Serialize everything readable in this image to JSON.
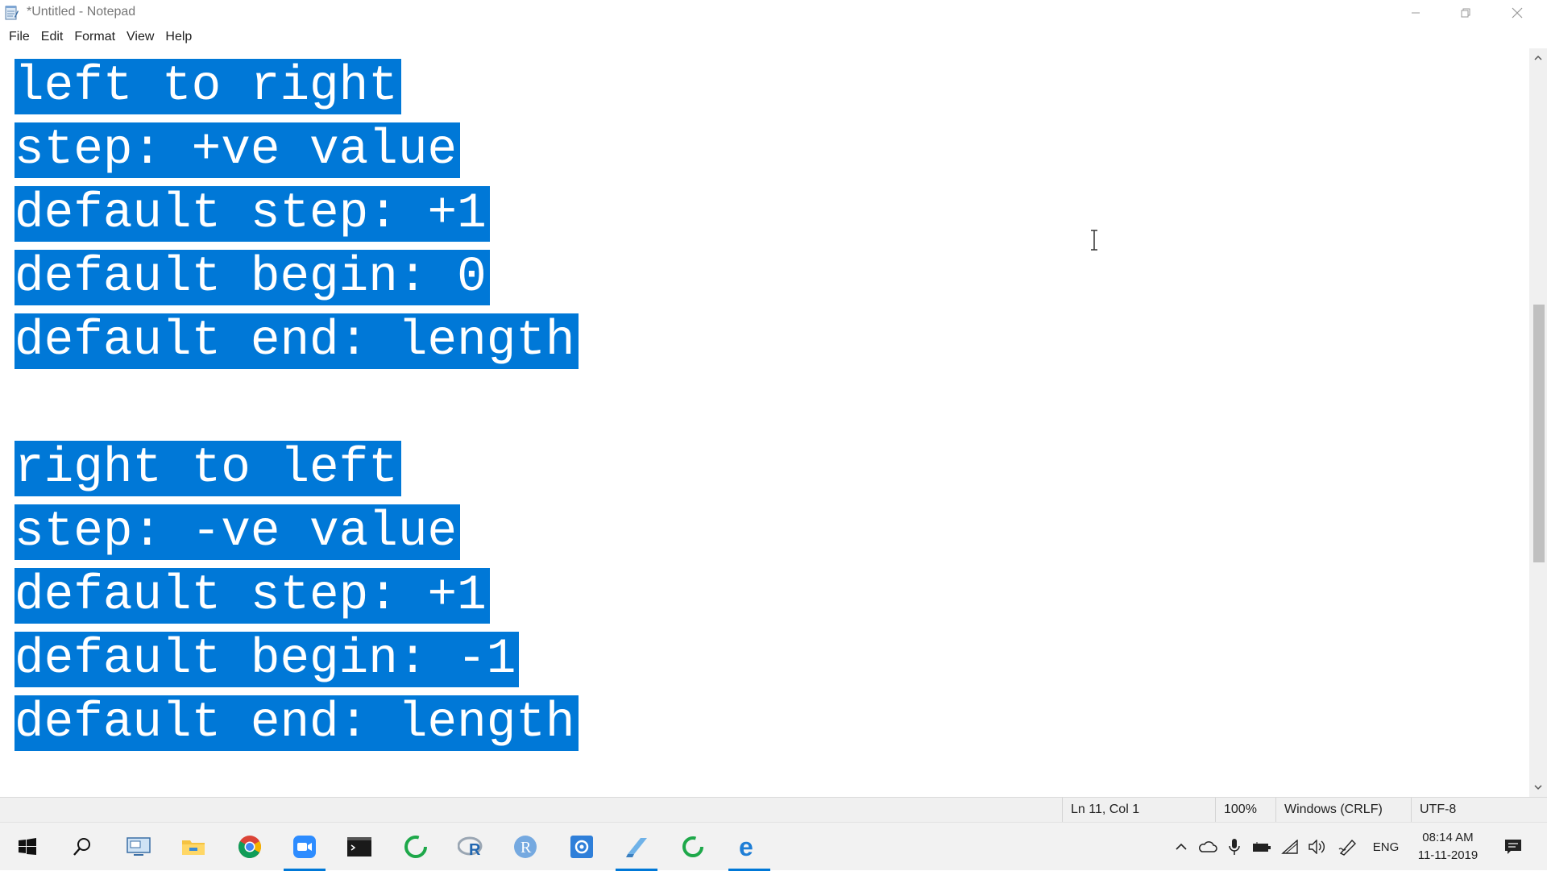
{
  "window": {
    "title": "*Untitled - Notepad"
  },
  "menu": {
    "items": [
      "File",
      "Edit",
      "Format",
      "View",
      "Help"
    ]
  },
  "editor": {
    "lines": [
      "left to right",
      "step: +ve value",
      "default step: +1",
      "default begin: 0",
      "default end: length",
      "",
      "right to left",
      "step: -ve value",
      "default step: +1",
      "default begin: -1",
      "default end: length"
    ],
    "selection_color": "#0078d7"
  },
  "statusbar": {
    "position": "Ln 11, Col 1",
    "zoom": "100%",
    "line_ending": "Windows (CRLF)",
    "encoding": "UTF-8"
  },
  "taskbar": {
    "apps": [
      {
        "name": "start-icon"
      },
      {
        "name": "search-icon"
      },
      {
        "name": "task-view-icon"
      },
      {
        "name": "file-explorer-icon"
      },
      {
        "name": "chrome-icon"
      },
      {
        "name": "zoom-icon"
      },
      {
        "name": "terminal-icon"
      },
      {
        "name": "refresh-app-icon"
      },
      {
        "name": "rstudio-icon"
      },
      {
        "name": "r-icon"
      },
      {
        "name": "settings-app-icon"
      },
      {
        "name": "notepad-icon"
      },
      {
        "name": "green-circle-app-icon"
      },
      {
        "name": "edge-icon"
      }
    ],
    "language": "ENG",
    "time": "08:14 AM",
    "date": "11-11-2019"
  }
}
